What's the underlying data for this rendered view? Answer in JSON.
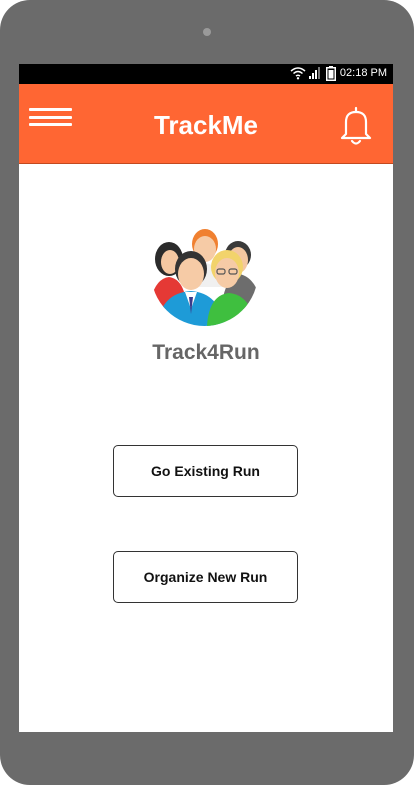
{
  "status_bar": {
    "time": "02:18 PM",
    "icons": [
      "wifi-icon",
      "signal-icon",
      "battery-icon"
    ]
  },
  "app_bar": {
    "title": "TrackMe",
    "menu_icon": "hamburger-menu-icon",
    "notification_icon": "bell-icon",
    "background_color": "#ff6633"
  },
  "main": {
    "logo_icon": "group-people-icon",
    "logo_label": "Track4Run",
    "buttons": {
      "existing": "Go Existing Run",
      "new": "Organize New Run"
    }
  }
}
